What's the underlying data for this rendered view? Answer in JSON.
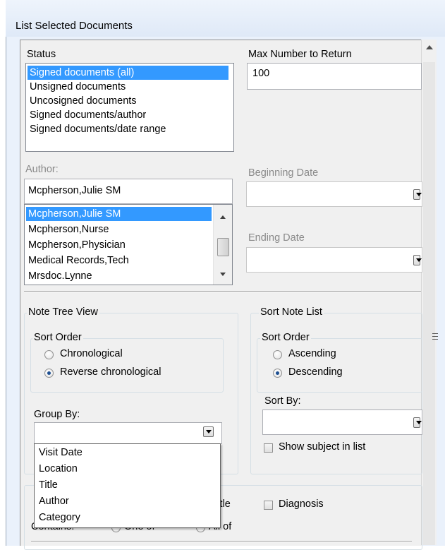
{
  "window": {
    "title": "List Selected Documents"
  },
  "status": {
    "label": "Status",
    "items": [
      "Signed documents (all)",
      "Unsigned documents",
      "Uncosigned documents",
      "Signed documents/author",
      "Signed documents/date range"
    ],
    "selected_index": 0
  },
  "max_return": {
    "label": "Max Number to Return",
    "value": "100"
  },
  "author": {
    "label": "Author:",
    "value": "Mcpherson,Julie SM",
    "items": [
      "Mcpherson,Julie SM",
      "Mcpherson,Nurse",
      "Mcpherson,Physician",
      "Medical Records,Tech",
      "Mrsdoc.Lynne"
    ],
    "selected_index": 0
  },
  "beginning_date": {
    "label": "Beginning Date",
    "value": ""
  },
  "ending_date": {
    "label": "Ending Date",
    "value": ""
  },
  "note_tree_view": {
    "label": "Note Tree View",
    "sort_order": {
      "label": "Sort Order",
      "options": [
        "Chronological",
        "Reverse chronological"
      ],
      "selected_index": 1
    },
    "group_by": {
      "label": "Group By:",
      "value": "",
      "options": [
        "Visit Date",
        "Location",
        "Title",
        "Author",
        "Category"
      ]
    }
  },
  "sort_note_list": {
    "label": "Sort Note List",
    "sort_order": {
      "label": "Sort Order",
      "options": [
        "Ascending",
        "Descending"
      ],
      "selected_index": 1
    },
    "sort_by": {
      "label": "Sort By:",
      "value": ""
    },
    "show_subject": {
      "label": "Show subject in list",
      "checked": false
    }
  },
  "search": {
    "title_partial": "Title",
    "diagnosis_label": "Diagnosis",
    "contains_partial": "Contains:",
    "one_of_partial": "One of",
    "all_of_partial": "All of"
  },
  "icons": {
    "dropdown": "chevron-down-icon",
    "scroll_up": "arrow-up-icon",
    "scroll_down": "arrow-down-icon",
    "resize": "resize-grip-icon"
  }
}
